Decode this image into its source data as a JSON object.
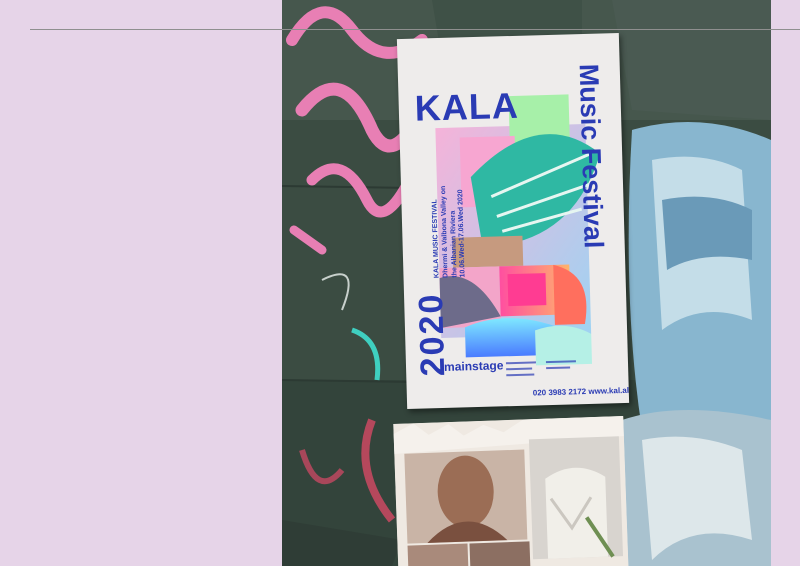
{
  "colors": {
    "background": "#e6d4e8",
    "wall": "#3c4d43",
    "poster_ink": "#2a3bb4",
    "graffiti": "#e87fb4"
  },
  "poster": {
    "title": "KALA",
    "vertical_title": "Music Festival",
    "year": "2020",
    "info_lines": [
      "KALA MUSIC FESTIVAL",
      "Dhermi & Valbona Valley on",
      "the Albanian Riviera",
      "10.06.Wed-17.06.Wed 2020"
    ],
    "stage": "mainstage",
    "contact": "020 3983 2172 www.kal.al"
  }
}
